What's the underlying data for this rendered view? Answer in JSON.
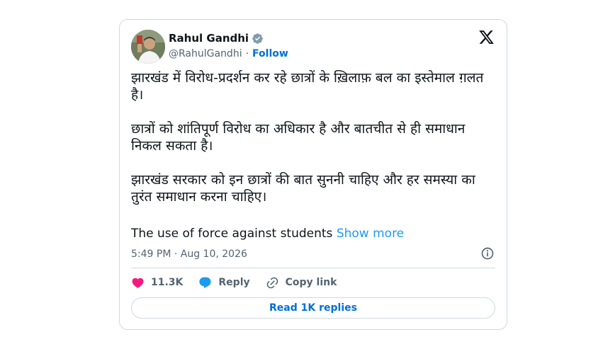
{
  "author": {
    "name": "Rahul Gandhi",
    "handle": "@RahulGandhi",
    "separator": "·",
    "follow_label": "Follow"
  },
  "tweet": {
    "paragraphs": [
      "झारखंड में विरोध-प्रदर्शन कर रहे छात्रों के ख़िलाफ़ बल का इस्तेमाल ग़लत है।",
      "छात्रों को शांतिपूर्ण विरोध का अधिकार है और बातचीत से ही समाधान निकल सकता है।",
      "झारखंड सरकार को इन छात्रों की बात सुननी चाहिए और हर समस्या का तुरंत समाधान करना चाहिए।"
    ],
    "english_text": "The use of force against students",
    "show_more_label": "Show more",
    "timestamp": "5:49 PM · Aug 10, 2026"
  },
  "actions": {
    "likes_count": "11.3K",
    "reply_label": "Reply",
    "copy_link_label": "Copy link"
  },
  "footer": {
    "read_replies_label": "Read 1K replies"
  },
  "colors": {
    "accent": "#1d9bf0",
    "link": "#006fd6",
    "like": "#f91880",
    "text": "#0f1419",
    "muted": "#536471",
    "border": "#cfd9de"
  },
  "icons": [
    "verified-badge-icon",
    "x-logo-icon",
    "info-icon",
    "heart-icon",
    "reply-bubble-icon",
    "link-icon"
  ]
}
